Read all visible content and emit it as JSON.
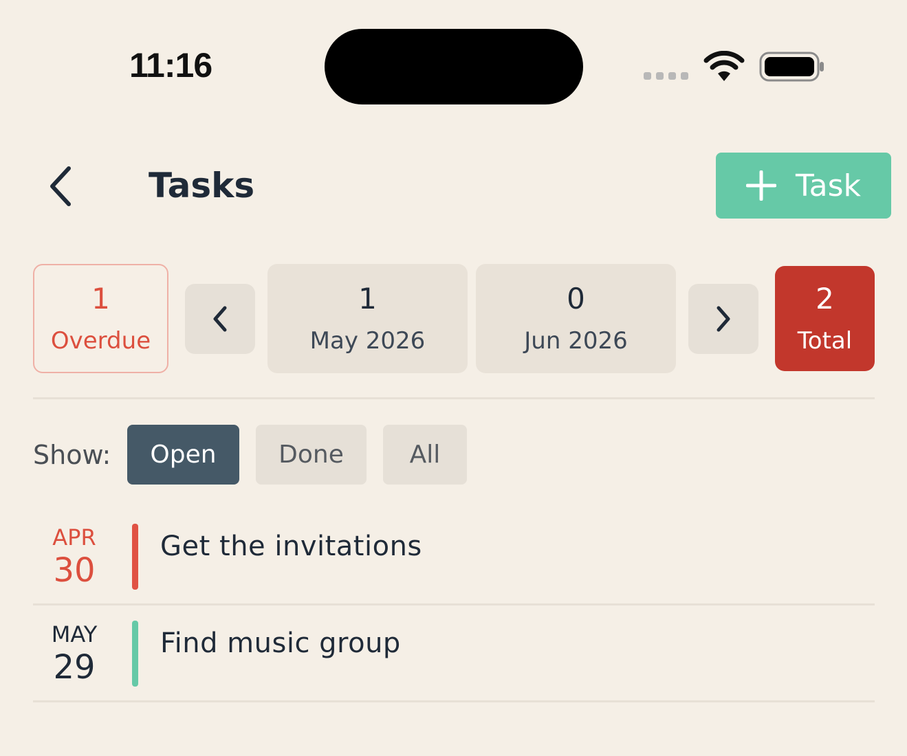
{
  "status_bar": {
    "time": "11:16"
  },
  "header": {
    "title": "Tasks",
    "add_button_label": "Task"
  },
  "summary": {
    "overdue": {
      "count": "1",
      "label": "Overdue"
    },
    "months": [
      {
        "count": "1",
        "label": "May 2026"
      },
      {
        "count": "0",
        "label": "Jun 2026"
      }
    ],
    "total": {
      "count": "2",
      "label": "Total"
    }
  },
  "filter": {
    "label": "Show:",
    "options": [
      "Open",
      "Done",
      "All"
    ],
    "selected": "Open"
  },
  "tasks": [
    {
      "month": "APR",
      "day": "30",
      "title": "Get the invitations",
      "status_color": "#e05244",
      "date_color": "#dc4f3e"
    },
    {
      "month": "MAY",
      "day": "29",
      "title": "Find music group",
      "status_color": "#66c9a7",
      "date_color": "#1f2a38"
    }
  ],
  "colors": {
    "background": "#f5efe6",
    "accent_green": "#66c9a7",
    "overdue_red": "#dc4f3e",
    "total_red": "#c2372c",
    "selected_filter": "#455967"
  }
}
